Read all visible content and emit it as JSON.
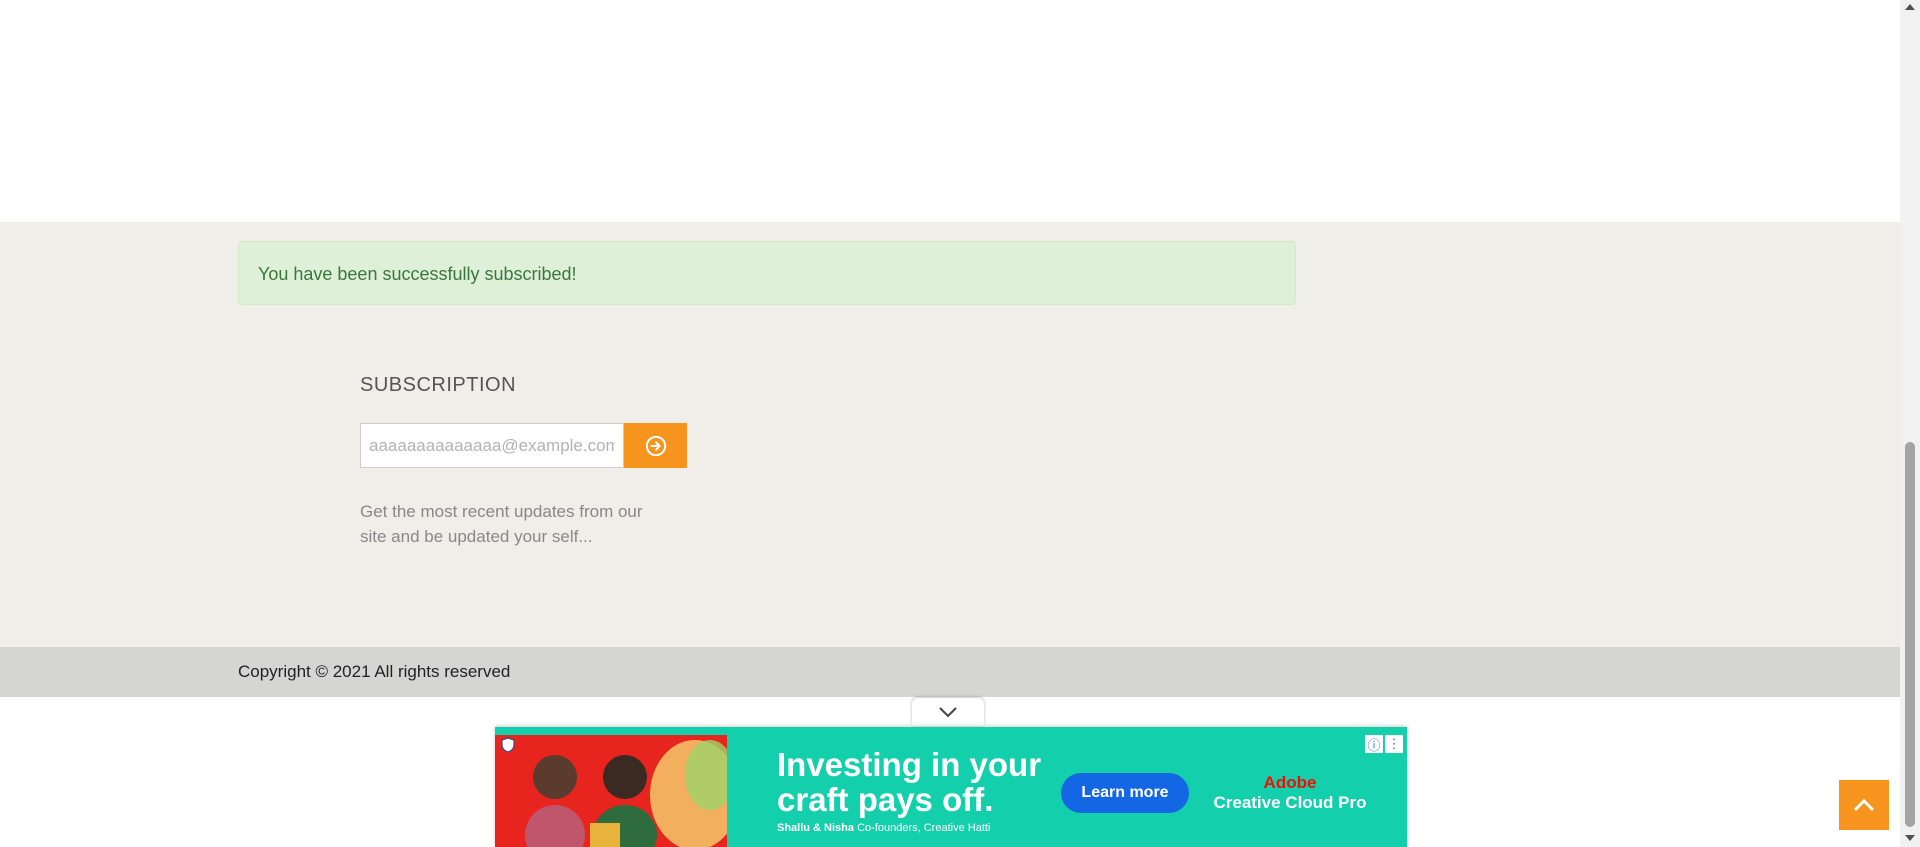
{
  "alert": {
    "message": "You have been successfully subscribed!"
  },
  "subscription": {
    "title": "SUBSCRIPTION",
    "email_value": "aaaaaaaaaaaaaa@example.com",
    "submit_icon": "arrow-circle-right-icon",
    "description": "Get the most recent updates from our site and be updated your self..."
  },
  "footer": {
    "copyright": "Copyright © 2021 All rights reserved"
  },
  "ad": {
    "headline_line1": "Investing in your",
    "headline_line2": "craft pays off.",
    "byline_names": "Shallu & Nisha",
    "byline_role": "Co-founders, Creative Hatti",
    "cta_label": "Learn more",
    "brand_name": "Adobe",
    "brand_product": "Creative Cloud Pro"
  },
  "colors": {
    "accent": "#f7941d",
    "footer_bg": "#efeee8",
    "copyright_bg": "#d5d6d1",
    "alert_bg": "#dff0d8",
    "alert_text": "#3c763d",
    "ad_bg": "#14cfab"
  }
}
